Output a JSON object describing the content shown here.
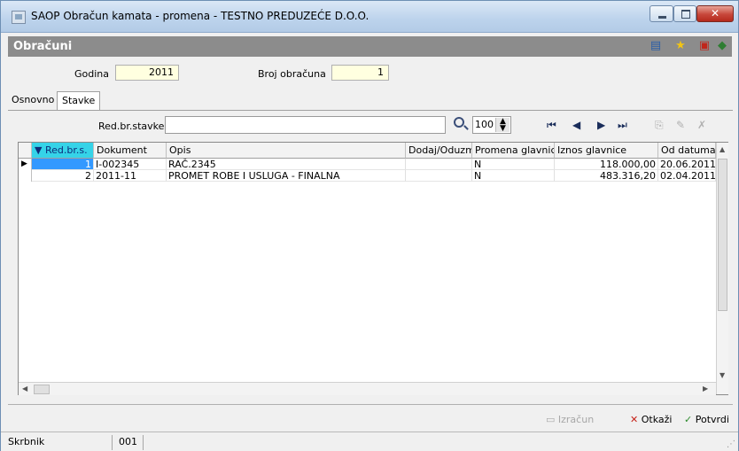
{
  "window": {
    "title": "SAOP Obračun kamata - promena - TESTNO PREDUZEĆE D.O.O."
  },
  "header": {
    "title": "Obračuni",
    "icons": [
      "grid-icon",
      "star-icon",
      "pdf-icon",
      "book-icon"
    ]
  },
  "fields": {
    "godina_label": "Godina",
    "godina_value": "2011",
    "broj_label": "Broj obračuna",
    "broj_value": "1"
  },
  "tabs": [
    {
      "label": "Osnovno",
      "active": false
    },
    {
      "label": "Stavke",
      "active": true
    }
  ],
  "search": {
    "label": "Red.br.stavke",
    "value": "",
    "page_size": "100"
  },
  "grid": {
    "columns": [
      "Red.br.s.",
      "Dokument",
      "Opis",
      "Dodaj/Oduzmi",
      "Promena glavnice",
      "Iznos glavnice",
      "Od datuma"
    ],
    "rows": [
      {
        "red": "1",
        "dokument": "I-002345",
        "opis": "RAČ.2345",
        "dodaj": "",
        "promena": "N",
        "iznos": "118.000,00",
        "od": "20.06.2011"
      },
      {
        "red": "2",
        "dokument": "2011-11",
        "opis": "PROMET ROBE I USLUGA - FINALNA",
        "dodaj": "",
        "promena": "N",
        "iznos": "483.316,20",
        "od": "02.04.2011"
      }
    ]
  },
  "buttons": {
    "izracun": "Izračun",
    "otkazi": "Otkaži",
    "potvrdi": "Potvrdi"
  },
  "status": {
    "user": "Skrbnik",
    "code": "001"
  },
  "colors": {
    "header_band": "#8c8c8c",
    "field_bg": "#ffffe0",
    "sorted_header": "#35d3e8",
    "selected": "#3399ff"
  }
}
